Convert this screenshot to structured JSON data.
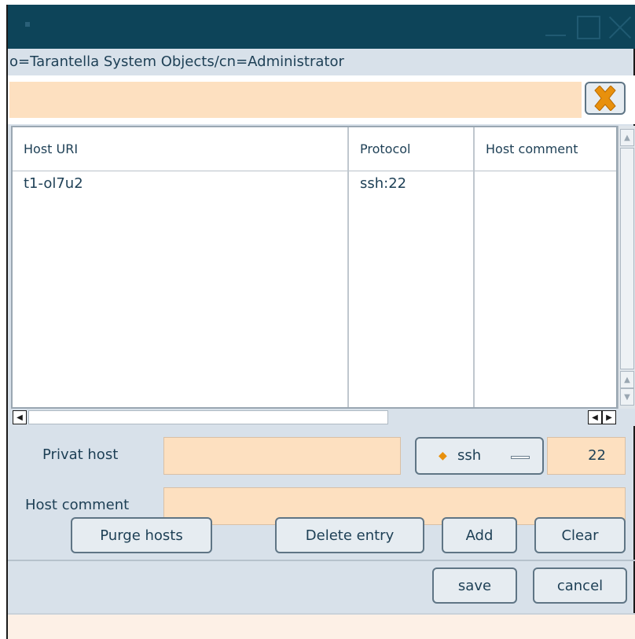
{
  "window": {
    "path": "o=Tarantella System Objects/cn=Administrator"
  },
  "filter": {
    "value": "",
    "clear_icon": "close-x-icon",
    "clear_icon_color": "#e8900c"
  },
  "table": {
    "columns": [
      "Host URI",
      "Protocol",
      "Host comment"
    ],
    "rows": [
      {
        "host_uri": "t1-ol7u2",
        "protocol": "ssh:22",
        "comment": ""
      }
    ]
  },
  "form": {
    "privat_host_label": "Privat host",
    "privat_host_value": "",
    "protocol_value": "ssh",
    "port_value": "22",
    "host_comment_label": "Host comment",
    "host_comment_value": ""
  },
  "buttons": {
    "purge": "Purge hosts",
    "delete": "Delete entry",
    "add": "Add",
    "clear": "Clear",
    "save": "save",
    "cancel": "cancel"
  },
  "colors": {
    "titlebar": "#0d4459",
    "input_bg": "#fde0c0",
    "panel_bg": "#d8e1ea",
    "text": "#1d3f55",
    "accent": "#e8900c"
  }
}
